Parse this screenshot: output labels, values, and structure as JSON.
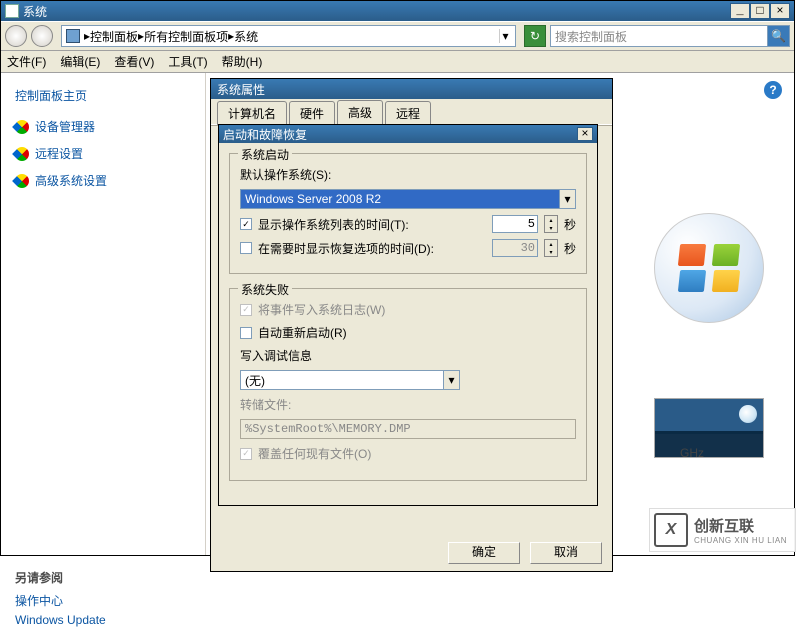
{
  "window": {
    "title": "系统",
    "min": "_",
    "max": "□",
    "close": "×"
  },
  "breadcrumb": {
    "p1": "控制面板",
    "p2": "所有控制面板项",
    "p3": "系统"
  },
  "search": {
    "placeholder": "搜索控制面板"
  },
  "menu": {
    "file": "文件(F)",
    "edit": "编辑(E)",
    "view": "查看(V)",
    "tools": "工具(T)",
    "help": "帮助(H)"
  },
  "sidebar": {
    "home": "控制面板主页",
    "items": [
      {
        "label": "设备管理器"
      },
      {
        "label": "远程设置"
      },
      {
        "label": "高级系统设置"
      }
    ],
    "seealso": "另请参阅",
    "link1": "操作中心",
    "link2": "Windows Update"
  },
  "right": {
    "ghz": "GHz"
  },
  "dlg1": {
    "title": "系统属性",
    "tabs": {
      "computer_name": "计算机名",
      "hardware": "硬件",
      "advanced": "高级",
      "remote": "远程"
    },
    "ok": "确定",
    "cancel": "取消"
  },
  "dlg2": {
    "title": "启动和故障恢复",
    "close": "×",
    "g1": {
      "caption": "系统启动",
      "default_os_lbl": "默认操作系统(S):",
      "default_os_val": "Windows Server 2008 R2",
      "show_list": "显示操作系统列表的时间(T):",
      "show_list_val": "5",
      "unit": "秒",
      "show_recovery": "在需要时显示恢复选项的时间(D):",
      "show_recovery_val": "30"
    },
    "g2": {
      "caption": "系统失败",
      "write_event": "将事件写入系统日志(W)",
      "auto_restart": "自动重新启动(R)",
      "write_debug": "写入调试信息",
      "none": "(无)",
      "dump_file": "转储文件:",
      "dump_path": "%SystemRoot%\\MEMORY.DMP",
      "overwrite": "覆盖任何现有文件(O)"
    }
  },
  "watermark": {
    "logo": "X",
    "cn": "创新互联",
    "en": "CHUANG XIN HU LIAN"
  }
}
